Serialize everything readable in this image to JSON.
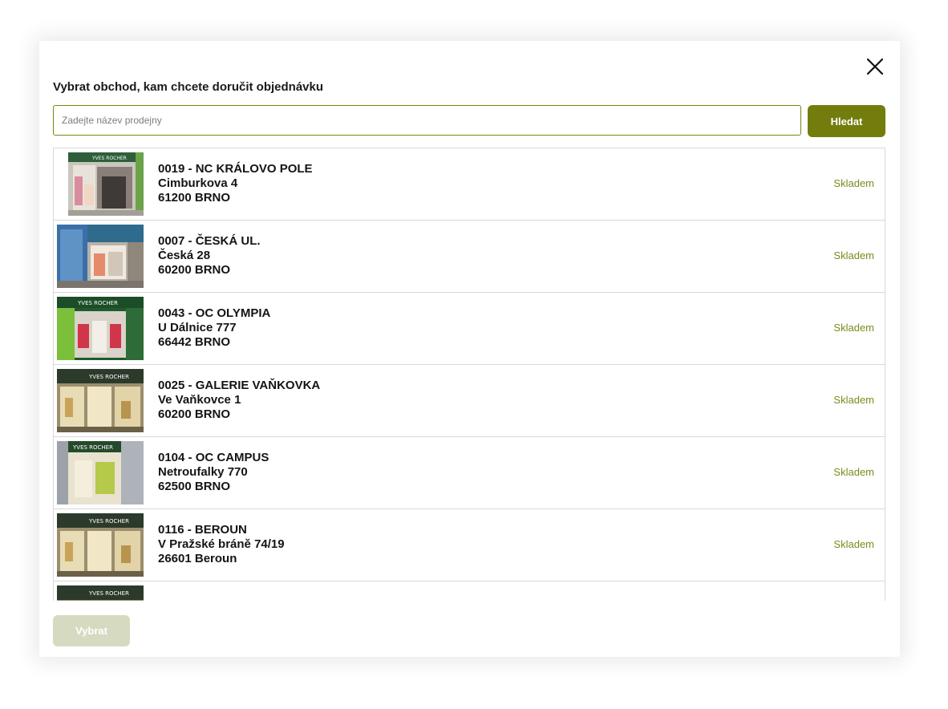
{
  "modal": {
    "title": "Vybrat obchod, kam chcete doručit objednávku",
    "close_icon": "close-icon"
  },
  "search": {
    "placeholder": "Zadejte název prodejny",
    "value": "",
    "button_label": "Hledat"
  },
  "stores": [
    {
      "name": "0019 - NC KRÁLOVO POLE",
      "street": "Cimburkova 4",
      "city": "61200 BRNO",
      "status": "Skladem"
    },
    {
      "name": "0007 - ČESKÁ UL.",
      "street": "Česká 28",
      "city": "60200 BRNO",
      "status": "Skladem"
    },
    {
      "name": "0043 - OC OLYMPIA",
      "street": "U Dálnice 777",
      "city": "66442 BRNO",
      "status": "Skladem"
    },
    {
      "name": "0025 - GALERIE VAŇKOVKA",
      "street": "Ve Vaňkovce 1",
      "city": "60200 BRNO",
      "status": "Skladem"
    },
    {
      "name": "0104 - OC CAMPUS",
      "street": "Netroufalky 770",
      "city": "62500 BRNO",
      "status": "Skladem"
    },
    {
      "name": "0116 - BEROUN",
      "street": "V Pražské bráně 74/19",
      "city": "26601 Beroun",
      "status": "Skladem"
    }
  ],
  "footer": {
    "select_label": "Vybrat"
  },
  "colors": {
    "accent": "#737d0d",
    "accent_disabled": "#d6dac0",
    "status": "#7d8a1c"
  }
}
